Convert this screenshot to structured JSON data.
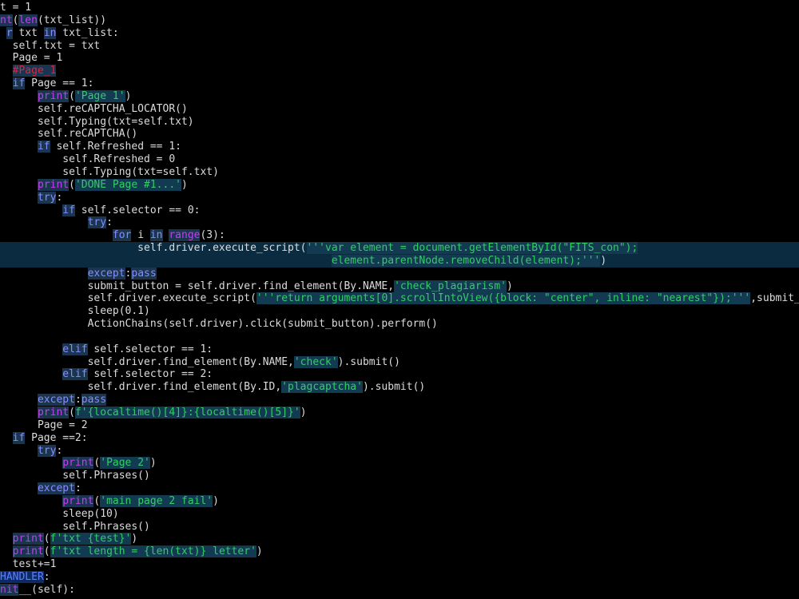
{
  "colors": {
    "background": "#000000",
    "text": "#dcdcdc",
    "keyword": "#8a8cff",
    "builtin": "#c23ff2",
    "string": "#33cc66",
    "comment": "#e0243c",
    "highlight_background": "#123b52"
  },
  "editor": {
    "lines": [
      {
        "tokens": [
          {
            "t": "t = 1",
            "c": "plain"
          }
        ]
      },
      {
        "tokens": [
          {
            "t": "nt",
            "c": "fn"
          },
          {
            "t": "(",
            "c": "plain"
          },
          {
            "t": "len",
            "c": "fn"
          },
          {
            "t": "(txt_list))",
            "c": "plain"
          }
        ]
      },
      {
        "tokens": [
          {
            "t": " ",
            "c": "plain"
          },
          {
            "t": "r",
            "c": "kw"
          },
          {
            "t": " txt ",
            "c": "plain"
          },
          {
            "t": "in",
            "c": "kw"
          },
          {
            "t": " txt_list:",
            "c": "plain"
          }
        ]
      },
      {
        "tokens": [
          {
            "t": "  self.txt = txt",
            "c": "plain"
          }
        ]
      },
      {
        "tokens": [
          {
            "t": "  Page = 1",
            "c": "plain"
          }
        ]
      },
      {
        "tokens": [
          {
            "t": "  ",
            "c": "plain"
          },
          {
            "t": "#Page_1",
            "c": "cmt"
          }
        ]
      },
      {
        "tokens": [
          {
            "t": "  ",
            "c": "plain"
          },
          {
            "t": "if",
            "c": "kw"
          },
          {
            "t": " Page == 1:",
            "c": "plain"
          }
        ]
      },
      {
        "tokens": [
          {
            "t": "      ",
            "c": "plain"
          },
          {
            "t": "print",
            "c": "fn"
          },
          {
            "t": "(",
            "c": "plain"
          },
          {
            "t": "'Page 1'",
            "c": "str"
          },
          {
            "t": ")",
            "c": "plain"
          }
        ]
      },
      {
        "tokens": [
          {
            "t": "      self.reCAPTCHA_LOCATOR()",
            "c": "plain"
          }
        ]
      },
      {
        "tokens": [
          {
            "t": "      self.Typing(txt=self.txt)",
            "c": "plain"
          }
        ]
      },
      {
        "tokens": [
          {
            "t": "      self.reCAPTCHA()",
            "c": "plain"
          }
        ]
      },
      {
        "tokens": [
          {
            "t": "      ",
            "c": "plain"
          },
          {
            "t": "if",
            "c": "kw"
          },
          {
            "t": " self.Refreshed == 1:",
            "c": "plain"
          }
        ]
      },
      {
        "tokens": [
          {
            "t": "          self.Refreshed = 0",
            "c": "plain"
          }
        ]
      },
      {
        "tokens": [
          {
            "t": "          self.Typing(txt=self.txt)",
            "c": "plain"
          }
        ]
      },
      {
        "tokens": [
          {
            "t": "      ",
            "c": "plain"
          },
          {
            "t": "print",
            "c": "fn"
          },
          {
            "t": "(",
            "c": "plain"
          },
          {
            "t": "'DONE Page #1...'",
            "c": "str"
          },
          {
            "t": ")",
            "c": "plain"
          }
        ]
      },
      {
        "tokens": [
          {
            "t": "      ",
            "c": "plain"
          },
          {
            "t": "try",
            "c": "kw"
          },
          {
            "t": ":",
            "c": "plain"
          }
        ]
      },
      {
        "tokens": [
          {
            "t": "          ",
            "c": "plain"
          },
          {
            "t": "if",
            "c": "kw"
          },
          {
            "t": " self.selector == 0:",
            "c": "plain"
          }
        ]
      },
      {
        "tokens": [
          {
            "t": "              ",
            "c": "plain"
          },
          {
            "t": "try",
            "c": "kw"
          },
          {
            "t": ":",
            "c": "plain"
          }
        ]
      },
      {
        "tokens": [
          {
            "t": "                  ",
            "c": "plain"
          },
          {
            "t": "for",
            "c": "kw"
          },
          {
            "t": " i ",
            "c": "plain"
          },
          {
            "t": "in",
            "c": "kw"
          },
          {
            "t": " ",
            "c": "plain"
          },
          {
            "t": "range",
            "c": "fn"
          },
          {
            "t": "(3):",
            "c": "plain"
          }
        ]
      },
      {
        "row": "hl",
        "tokens": [
          {
            "t": "                      self.driver.execute_script(",
            "c": "plain"
          },
          {
            "t": "'''var element = document.getElementById(\"FITS_con\");",
            "c": "str"
          }
        ]
      },
      {
        "row": "hl",
        "tokens": [
          {
            "t": "                                                     ",
            "c": "plain"
          },
          {
            "t": "element.parentNode.removeChild(element);'''",
            "c": "str"
          },
          {
            "t": ")",
            "c": "plain"
          }
        ]
      },
      {
        "tokens": [
          {
            "t": "              ",
            "c": "plain"
          },
          {
            "t": "except",
            "c": "kw"
          },
          {
            "t": ":",
            "c": "plain"
          },
          {
            "t": "pass",
            "c": "kw"
          }
        ]
      },
      {
        "tokens": [
          {
            "t": "              submit_button = self.driver.find_element(By.NAME,",
            "c": "plain"
          },
          {
            "t": "'check_plagiarism'",
            "c": "str"
          },
          {
            "t": ")",
            "c": "plain"
          }
        ]
      },
      {
        "tokens": [
          {
            "t": "              self.driver.execute_script(",
            "c": "plain"
          },
          {
            "t": "'''return arguments[0].scrollIntoView({block: \"center\", inline: \"nearest\"});'''",
            "c": "str"
          },
          {
            "t": ",submit_",
            "c": "plain"
          }
        ]
      },
      {
        "tokens": [
          {
            "t": "              sleep(0.1)",
            "c": "plain"
          }
        ]
      },
      {
        "tokens": [
          {
            "t": "              ActionChains(self.driver).click(submit_button).perform()",
            "c": "plain"
          }
        ]
      },
      {
        "tokens": [
          {
            "t": "",
            "c": "plain"
          }
        ]
      },
      {
        "tokens": [
          {
            "t": "          ",
            "c": "plain"
          },
          {
            "t": "elif",
            "c": "kw"
          },
          {
            "t": " self.selector == 1:",
            "c": "plain"
          }
        ]
      },
      {
        "tokens": [
          {
            "t": "              self.driver.find_element(By.NAME,",
            "c": "plain"
          },
          {
            "t": "'check'",
            "c": "str"
          },
          {
            "t": ").submit()",
            "c": "plain"
          }
        ]
      },
      {
        "tokens": [
          {
            "t": "          ",
            "c": "plain"
          },
          {
            "t": "elif",
            "c": "kw"
          },
          {
            "t": " self.selector == 2:",
            "c": "plain"
          }
        ]
      },
      {
        "tokens": [
          {
            "t": "              self.driver.find_element(By.ID,",
            "c": "plain"
          },
          {
            "t": "'plagcaptcha'",
            "c": "str"
          },
          {
            "t": ").submit()",
            "c": "plain"
          }
        ]
      },
      {
        "tokens": [
          {
            "t": "      ",
            "c": "plain"
          },
          {
            "t": "except",
            "c": "kw"
          },
          {
            "t": ":",
            "c": "plain"
          },
          {
            "t": "pass",
            "c": "kw"
          }
        ]
      },
      {
        "tokens": [
          {
            "t": "      ",
            "c": "plain"
          },
          {
            "t": "print",
            "c": "fn"
          },
          {
            "t": "(",
            "c": "plain"
          },
          {
            "t": "f'{localtime()[4]}:{localtime()[5]}'",
            "c": "str"
          },
          {
            "t": ")",
            "c": "plain"
          }
        ]
      },
      {
        "tokens": [
          {
            "t": "      Page = 2",
            "c": "plain"
          }
        ]
      },
      {
        "tokens": [
          {
            "t": "  ",
            "c": "plain"
          },
          {
            "t": "if",
            "c": "kw"
          },
          {
            "t": " Page ==2:",
            "c": "plain"
          }
        ]
      },
      {
        "tokens": [
          {
            "t": "      ",
            "c": "plain"
          },
          {
            "t": "try",
            "c": "kw"
          },
          {
            "t": ":",
            "c": "plain"
          }
        ]
      },
      {
        "tokens": [
          {
            "t": "          ",
            "c": "plain"
          },
          {
            "t": "print",
            "c": "fn"
          },
          {
            "t": "(",
            "c": "plain"
          },
          {
            "t": "'Page 2'",
            "c": "str"
          },
          {
            "t": ")",
            "c": "plain"
          }
        ]
      },
      {
        "tokens": [
          {
            "t": "          self.Phrases()",
            "c": "plain"
          }
        ]
      },
      {
        "tokens": [
          {
            "t": "      ",
            "c": "plain"
          },
          {
            "t": "except",
            "c": "kw"
          },
          {
            "t": ":",
            "c": "plain"
          }
        ]
      },
      {
        "tokens": [
          {
            "t": "          ",
            "c": "plain"
          },
          {
            "t": "print",
            "c": "fn"
          },
          {
            "t": "(",
            "c": "plain"
          },
          {
            "t": "'main page 2 fail'",
            "c": "str"
          },
          {
            "t": ")",
            "c": "plain"
          }
        ]
      },
      {
        "tokens": [
          {
            "t": "          sleep(10)",
            "c": "plain"
          }
        ]
      },
      {
        "tokens": [
          {
            "t": "          self.Phrases()",
            "c": "plain"
          }
        ]
      },
      {
        "tokens": [
          {
            "t": "  ",
            "c": "plain"
          },
          {
            "t": "print",
            "c": "fn"
          },
          {
            "t": "(",
            "c": "plain"
          },
          {
            "t": "f'txt {test}'",
            "c": "str"
          },
          {
            "t": ")",
            "c": "plain"
          }
        ]
      },
      {
        "tokens": [
          {
            "t": "  ",
            "c": "plain"
          },
          {
            "t": "print",
            "c": "fn"
          },
          {
            "t": "(",
            "c": "plain"
          },
          {
            "t": "f'txt length = {len(txt)} letter'",
            "c": "str"
          },
          {
            "t": ")",
            "c": "plain"
          }
        ]
      },
      {
        "tokens": [
          {
            "t": "  test+=1",
            "c": "plain"
          }
        ]
      },
      {
        "tokens": [
          {
            "t": "HANDLER",
            "c": "cls"
          },
          {
            "t": ":",
            "c": "plain"
          }
        ]
      },
      {
        "tokens": [
          {
            "t": "nit",
            "c": "fn"
          },
          {
            "t": "__(self):",
            "c": "plain"
          }
        ]
      }
    ]
  }
}
